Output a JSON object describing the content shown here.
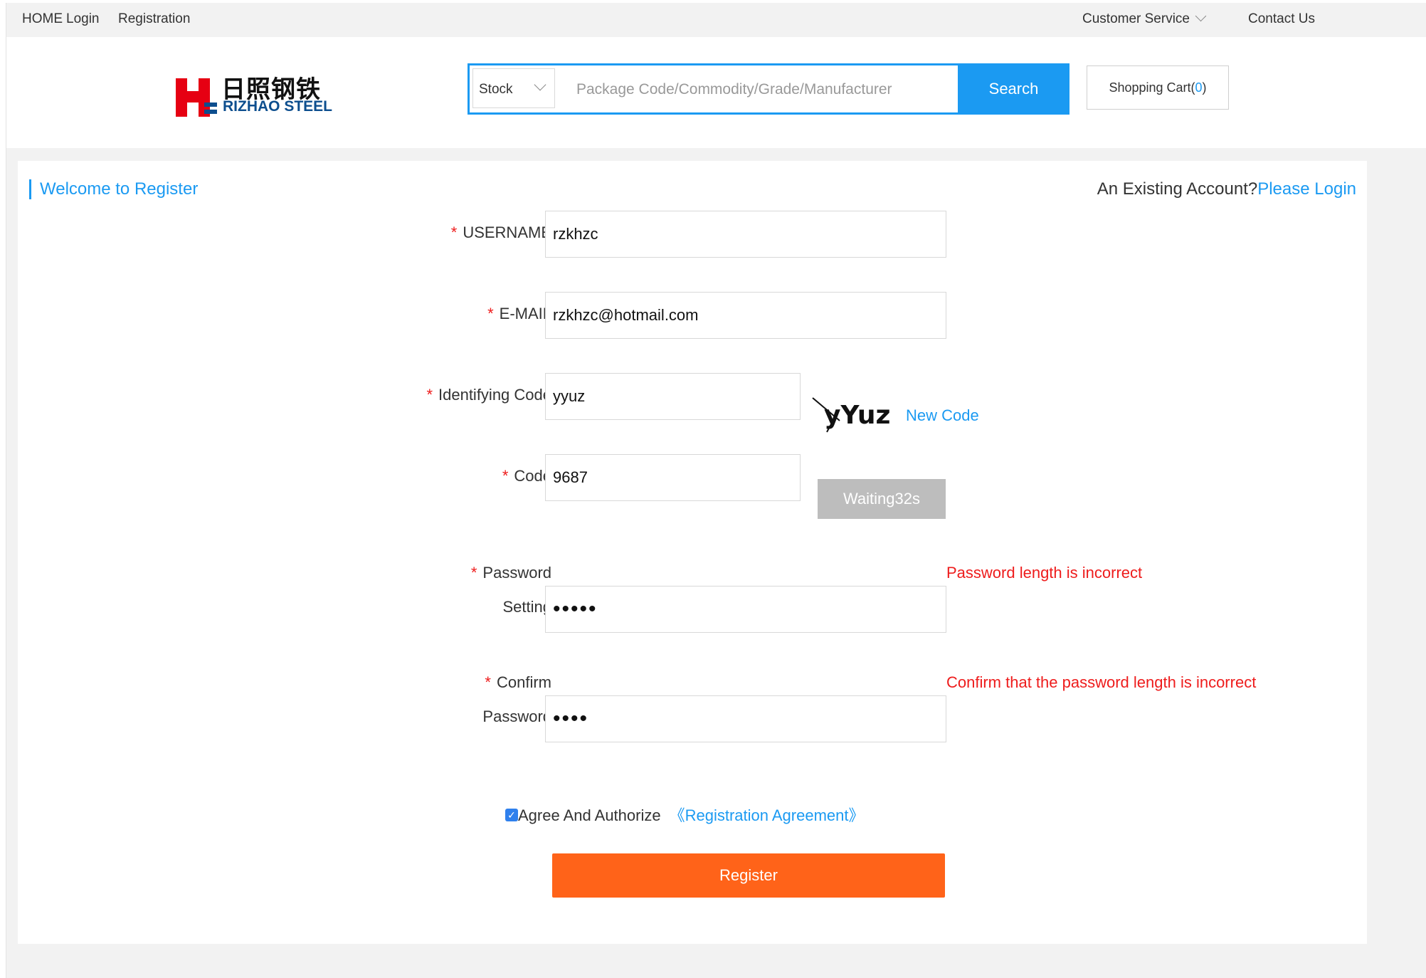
{
  "topbar": {
    "home": "HOME",
    "login": "Login",
    "registration": "Registration",
    "customer_service": "Customer Service",
    "contact_us": "Contact Us"
  },
  "header": {
    "logo_cn": "日照钢铁",
    "logo_en": "RIZHAO STEEL",
    "search": {
      "category": "Stock",
      "placeholder": "Package Code/Commodity/Grade/Manufacturer",
      "button": "Search"
    },
    "cart": {
      "label": "Shopping Cart(",
      "count": "0",
      "close": ")"
    }
  },
  "register": {
    "welcome": "Welcome to Register",
    "existing_prompt": "An Existing Account?",
    "login_link": "Please Login",
    "required_mark": "*",
    "username": {
      "label": "USERNAME",
      "value": "rzkhzc"
    },
    "email": {
      "label": "E-MAIL",
      "value": "rzkhzc@hotmail.com"
    },
    "identifying_code": {
      "label": "Identifying Code",
      "value": "yyuz",
      "captcha_text": "yYuz",
      "new_code": "New Code"
    },
    "code": {
      "label": "Code",
      "value": "9687",
      "wait_button": "Waiting32s"
    },
    "password": {
      "label_line1": "Password",
      "label_line2": "Setting",
      "value": "•••••",
      "error": "Password length is incorrect"
    },
    "confirm": {
      "label_line1": "Confirm",
      "label_line2": "Password",
      "value": "••••",
      "error": "Confirm that the password length is incorrect"
    },
    "agree": {
      "checked": true,
      "text": "Agree And Authorize",
      "link": "《Registration Agreement》"
    },
    "submit": "Register"
  },
  "colors": {
    "accent": "#1b9af2",
    "error": "#ee1c1c",
    "register_button": "#ff6319",
    "logo_red": "#e60012",
    "logo_blue": "#0d4e8e"
  }
}
